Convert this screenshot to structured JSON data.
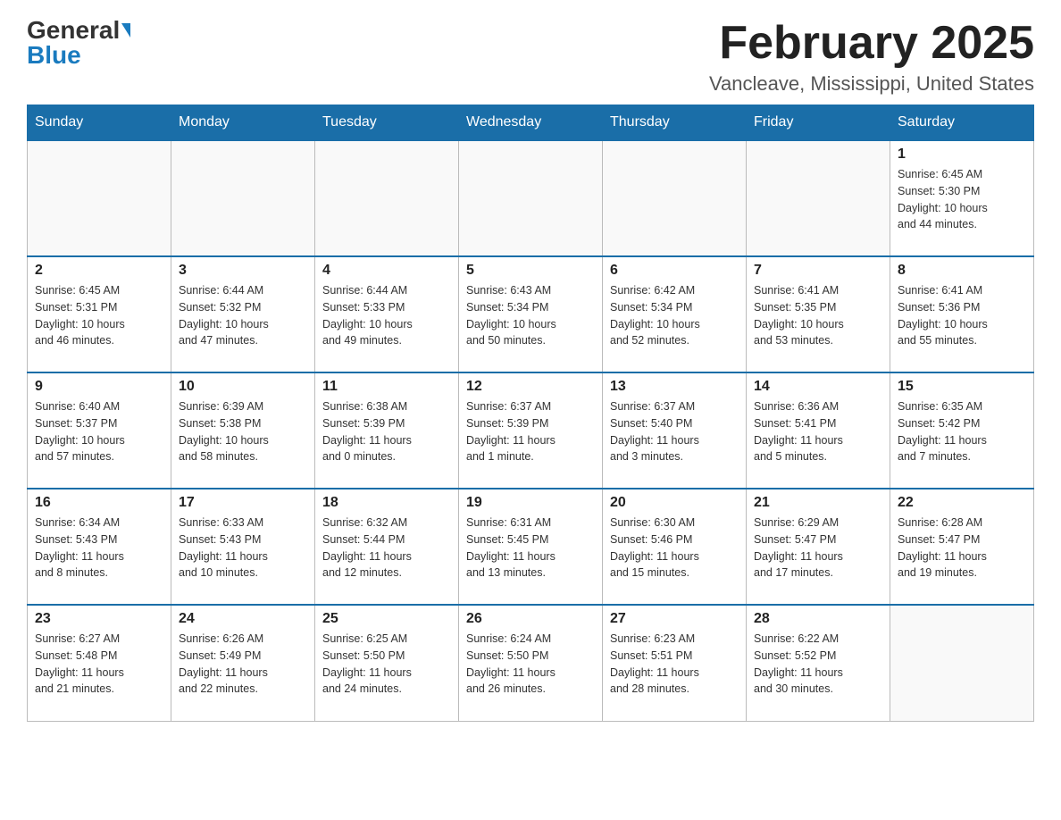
{
  "header": {
    "logo_general": "General",
    "logo_blue": "Blue",
    "title": "February 2025",
    "subtitle": "Vancleave, Mississippi, United States"
  },
  "weekdays": [
    "Sunday",
    "Monday",
    "Tuesday",
    "Wednesday",
    "Thursday",
    "Friday",
    "Saturday"
  ],
  "weeks": [
    [
      {
        "day": "",
        "info": ""
      },
      {
        "day": "",
        "info": ""
      },
      {
        "day": "",
        "info": ""
      },
      {
        "day": "",
        "info": ""
      },
      {
        "day": "",
        "info": ""
      },
      {
        "day": "",
        "info": ""
      },
      {
        "day": "1",
        "info": "Sunrise: 6:45 AM\nSunset: 5:30 PM\nDaylight: 10 hours\nand 44 minutes."
      }
    ],
    [
      {
        "day": "2",
        "info": "Sunrise: 6:45 AM\nSunset: 5:31 PM\nDaylight: 10 hours\nand 46 minutes."
      },
      {
        "day": "3",
        "info": "Sunrise: 6:44 AM\nSunset: 5:32 PM\nDaylight: 10 hours\nand 47 minutes."
      },
      {
        "day": "4",
        "info": "Sunrise: 6:44 AM\nSunset: 5:33 PM\nDaylight: 10 hours\nand 49 minutes."
      },
      {
        "day": "5",
        "info": "Sunrise: 6:43 AM\nSunset: 5:34 PM\nDaylight: 10 hours\nand 50 minutes."
      },
      {
        "day": "6",
        "info": "Sunrise: 6:42 AM\nSunset: 5:34 PM\nDaylight: 10 hours\nand 52 minutes."
      },
      {
        "day": "7",
        "info": "Sunrise: 6:41 AM\nSunset: 5:35 PM\nDaylight: 10 hours\nand 53 minutes."
      },
      {
        "day": "8",
        "info": "Sunrise: 6:41 AM\nSunset: 5:36 PM\nDaylight: 10 hours\nand 55 minutes."
      }
    ],
    [
      {
        "day": "9",
        "info": "Sunrise: 6:40 AM\nSunset: 5:37 PM\nDaylight: 10 hours\nand 57 minutes."
      },
      {
        "day": "10",
        "info": "Sunrise: 6:39 AM\nSunset: 5:38 PM\nDaylight: 10 hours\nand 58 minutes."
      },
      {
        "day": "11",
        "info": "Sunrise: 6:38 AM\nSunset: 5:39 PM\nDaylight: 11 hours\nand 0 minutes."
      },
      {
        "day": "12",
        "info": "Sunrise: 6:37 AM\nSunset: 5:39 PM\nDaylight: 11 hours\nand 1 minute."
      },
      {
        "day": "13",
        "info": "Sunrise: 6:37 AM\nSunset: 5:40 PM\nDaylight: 11 hours\nand 3 minutes."
      },
      {
        "day": "14",
        "info": "Sunrise: 6:36 AM\nSunset: 5:41 PM\nDaylight: 11 hours\nand 5 minutes."
      },
      {
        "day": "15",
        "info": "Sunrise: 6:35 AM\nSunset: 5:42 PM\nDaylight: 11 hours\nand 7 minutes."
      }
    ],
    [
      {
        "day": "16",
        "info": "Sunrise: 6:34 AM\nSunset: 5:43 PM\nDaylight: 11 hours\nand 8 minutes."
      },
      {
        "day": "17",
        "info": "Sunrise: 6:33 AM\nSunset: 5:43 PM\nDaylight: 11 hours\nand 10 minutes."
      },
      {
        "day": "18",
        "info": "Sunrise: 6:32 AM\nSunset: 5:44 PM\nDaylight: 11 hours\nand 12 minutes."
      },
      {
        "day": "19",
        "info": "Sunrise: 6:31 AM\nSunset: 5:45 PM\nDaylight: 11 hours\nand 13 minutes."
      },
      {
        "day": "20",
        "info": "Sunrise: 6:30 AM\nSunset: 5:46 PM\nDaylight: 11 hours\nand 15 minutes."
      },
      {
        "day": "21",
        "info": "Sunrise: 6:29 AM\nSunset: 5:47 PM\nDaylight: 11 hours\nand 17 minutes."
      },
      {
        "day": "22",
        "info": "Sunrise: 6:28 AM\nSunset: 5:47 PM\nDaylight: 11 hours\nand 19 minutes."
      }
    ],
    [
      {
        "day": "23",
        "info": "Sunrise: 6:27 AM\nSunset: 5:48 PM\nDaylight: 11 hours\nand 21 minutes."
      },
      {
        "day": "24",
        "info": "Sunrise: 6:26 AM\nSunset: 5:49 PM\nDaylight: 11 hours\nand 22 minutes."
      },
      {
        "day": "25",
        "info": "Sunrise: 6:25 AM\nSunset: 5:50 PM\nDaylight: 11 hours\nand 24 minutes."
      },
      {
        "day": "26",
        "info": "Sunrise: 6:24 AM\nSunset: 5:50 PM\nDaylight: 11 hours\nand 26 minutes."
      },
      {
        "day": "27",
        "info": "Sunrise: 6:23 AM\nSunset: 5:51 PM\nDaylight: 11 hours\nand 28 minutes."
      },
      {
        "day": "28",
        "info": "Sunrise: 6:22 AM\nSunset: 5:52 PM\nDaylight: 11 hours\nand 30 minutes."
      },
      {
        "day": "",
        "info": ""
      }
    ]
  ]
}
